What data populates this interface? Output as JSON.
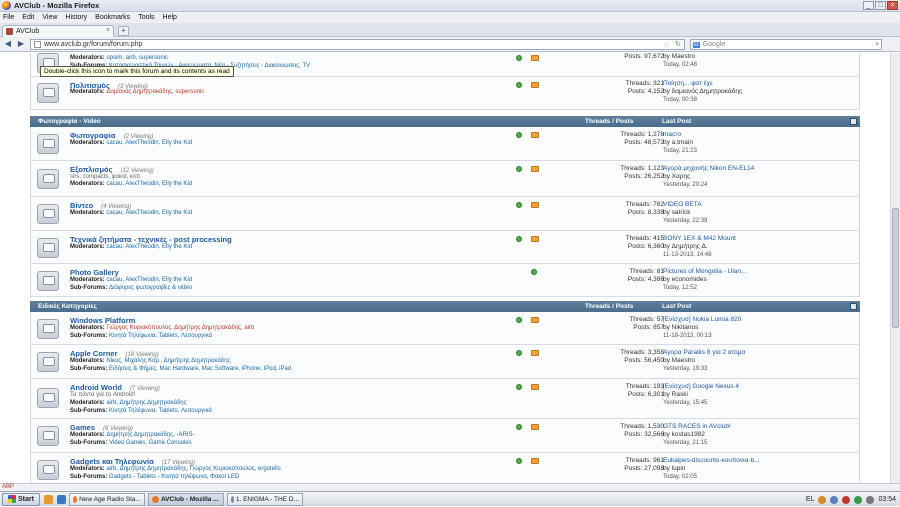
{
  "window": {
    "title": "AVClub - Mozilla Firefox"
  },
  "menu": [
    "File",
    "Edit",
    "View",
    "History",
    "Bookmarks",
    "Tools",
    "Help"
  ],
  "tab": {
    "label": "AVClub",
    "close": "×",
    "new_tab": "+"
  },
  "nav": {
    "back": "◀",
    "forward": "▶",
    "url": "www.avclub.gr/forum/forum.php",
    "search_engine": "G",
    "search_placeholder": "Google"
  },
  "tooltip": "Double-click this icon to mark this forum and its contents as read",
  "top_forums": [
    {
      "moderators_label": "Moderators:",
      "moderators": "opsim, airb, supersonic",
      "sub_label": "Sub-Forums:",
      "subs": "Κατασκευαστικά Ταινιών · Αφιερώματα, Νέα - Συζητήσεις - Διακοινωσεις, TV",
      "threads": "",
      "posts": "Posts: 97,672",
      "lp_title": "",
      "lp_by": "by Maestro",
      "lp_date": "Today, 02:48"
    },
    {
      "name": "Πολιτισμός",
      "viewing": "(3 Viewing)",
      "moderators_label": "Moderators:",
      "moderators": "Δαμιανός Δημητρακάδης, supersonic",
      "threads": "Threads: 321",
      "posts": "Posts: 4,152",
      "lp_title": "Ποίηση....φατ έχε",
      "lp_by": "by δαμιανός Δημητρακάδης",
      "lp_date": "Today, 00:38"
    }
  ],
  "cat1": {
    "title": "Φωτογραφία - Video",
    "tp": "Threads / Posts",
    "lp": "Last Post"
  },
  "cat1_forums": [
    {
      "name": "Φωτογραφία",
      "viewing": "(2 Viewing)",
      "line1": "cacau, AlexTheodin, Elly the Kid",
      "threads": "Threads: 1,278",
      "posts": "Posts: 48,572",
      "lp_title": "macro",
      "lp_by": "by a.tmain",
      "lp_date": "Today, 21:23"
    },
    {
      "name": "Εξοπλισμός",
      "viewing": "(12 Viewing)",
      "desc": "slrs, compacts, φακοί, κλπ",
      "line1": "cacau, AlexTheodin, Elly the Kid",
      "threads": "Threads: 1,123",
      "posts": "Posts: 26,252",
      "lp_title": "Αγορά μηχανής Nikon EN-EL14",
      "lp_by": "by Χαρης",
      "lp_date": "Yesterday, 20:24"
    },
    {
      "name": "Βίντεο",
      "viewing": "(4 Viewing)",
      "line1": "cacau, AlexTheodin, Elly the Kid",
      "threads": "Threads: 762",
      "posts": "Posts: 8,338",
      "lp_title": "VIDEO BETA",
      "lp_by": "by satrick",
      "lp_date": "Yesterday, 22:39"
    },
    {
      "name": "Τεχνικά ζητήματα - τεχνικές - post processing",
      "viewing": "",
      "line1": "cacau, AlexTheodin, Elly the Kid",
      "threads": "Threads: 415",
      "posts": "Posts: 6,360",
      "lp_title": "SONY 1EX & M42 Mount",
      "lp_by": "by Δημήτρης Δ.",
      "lp_date": "11-13-2013, 14:48"
    },
    {
      "name": "Photo Gallery",
      "viewing": "",
      "line1": "cacau, AlexTheodin, Elly the Kid",
      "subs": "Διάφορες φωτογραφίες & video",
      "threads": "Threads: 81",
      "posts": "Posts: 4,386",
      "lp_title": "Pictures of Mongolia - Ulan...",
      "lp_by": "by economides",
      "lp_date": "Today, 12:52"
    }
  ],
  "cat2": {
    "title": "Ειδικές Κατηγορίες",
    "tp": "Threads / Posts",
    "lp": "Last Post"
  },
  "cat2_forums": [
    {
      "name": "Windows Platform",
      "viewing": "",
      "line1": "Γιώργος Κυριακόπουλος, Δημήτρης Δημητρακάδης, airb",
      "subs": "Κινητά Τηλέφωνα, Tablets, Λειτουργικά",
      "threads": "Threads: 57",
      "posts": "Posts: 857",
      "lp_title": "[Ενίσχυσ] Nokia Lumia 820",
      "lp_by": "by Nikitanos",
      "lp_date": "11-18-2013, 00:13"
    },
    {
      "name": "Apple Corner",
      "viewing": "(18 Viewing)",
      "line1": "Νίκος, Μιχάλης Καρ., Δημήτρης Δημητρακάδης",
      "subs": "Ειδήσεις & Φήμες, Mac Hardware, Mac Software, iPhone, iPod, iPad",
      "threads": "Threads: 3,358",
      "posts": "Posts: 56,450",
      "lp_title": "Αγορα Paraiks 8 για 2 ατομα",
      "lp_by": "by Maestro",
      "lp_date": "Yesterday, 19:33"
    },
    {
      "name": "Android World",
      "viewing": "(7 Viewing)",
      "desc": "Τα πάντα για το Android!",
      "line1": "airb, Δημήτρης Δημητρακάδης",
      "subs": "Κινητά Τηλέφωνα, Tablets, Λειτουργικά",
      "threads": "Threads: 193",
      "posts": "Posts: 6,301",
      "lp_title": "[Ενίσχυσ] Google Nexus 4",
      "lp_by": "by Raski",
      "lp_date": "Yesterday, 15:45"
    },
    {
      "name": "Games",
      "viewing": "(6 Viewing)",
      "line1": "Δημήτρης Δημητρακάδης, -ARIS-",
      "subs": "Video Games, Game Consoles",
      "threads": "Threads: 1,530",
      "posts": "Posts: 32,566",
      "lp_title": "GTS RACES in AVclub!",
      "lp_by": "by kostas1982",
      "lp_date": "Yesterday, 21:15"
    },
    {
      "name": "Gadgets και Τηλεφωνία",
      "viewing": "(17 Viewing)",
      "line1": "airb, Δημήτρης Δημητρακάδης, Γιώργος Κυριακόπουλος, ergotelis",
      "subs": "Gadgets - Tablets - Κινητά τηλέφωνα, Φακοί LED",
      "threads": "Threads: 961",
      "posts": "Posts: 27,098",
      "lp_title": "Eukaipes-discounts-κουπονια-b...",
      "lp_by": "by lupin",
      "lp_date": "Today, 02:05"
    }
  ],
  "labels": {
    "moderators": "Moderators:",
    "subforums": "Sub-Forums:"
  },
  "taskbar": {
    "start": "Start",
    "items": [
      "New Age Radio Sta...",
      "AVClub - Mozilla ...",
      "1. ENIGMA - THE D..."
    ],
    "lang": "EL",
    "clock": "03:54"
  },
  "statusbar": {
    "abp": "ABP"
  }
}
